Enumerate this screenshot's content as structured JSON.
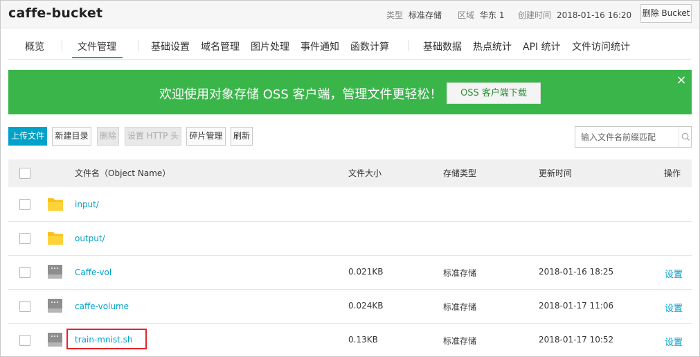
{
  "header": {
    "bucket_name": "caffe-bucket",
    "type_label": "类型",
    "type_value": "标准存储",
    "region_label": "区域",
    "region_value": "华东 1",
    "created_label": "创建时间",
    "created_value": "2018-01-16 16:20",
    "delete_button": "删除 Bucket"
  },
  "tabs": [
    {
      "label": "概览"
    },
    {
      "label": "文件管理"
    },
    {
      "label": "基础设置"
    },
    {
      "label": "域名管理"
    },
    {
      "label": "图片处理"
    },
    {
      "label": "事件通知"
    },
    {
      "label": "函数计算"
    },
    {
      "label": "基础数据"
    },
    {
      "label": "热点统计"
    },
    {
      "label": "API 统计"
    },
    {
      "label": "文件访问统计"
    }
  ],
  "active_tab": "文件管理",
  "banner": {
    "text": "欢迎使用对象存储 OSS 客户端，管理文件更轻松！",
    "button": "OSS 客户端下载",
    "close": "×"
  },
  "toolbar": {
    "upload": "上传文件",
    "new_dir": "新建目录",
    "delete": "删除",
    "set_http_header": "设置 HTTP 头",
    "fragments": "碎片管理",
    "refresh": "刷新",
    "search_placeholder": "输入文件名前缀匹配"
  },
  "table": {
    "columns": {
      "name": "文件名（Object Name）",
      "size": "文件大小",
      "storage": "存储类型",
      "updated": "更新时间",
      "actions": "操作"
    },
    "rows": [
      {
        "type": "folder",
        "name": "input/",
        "size": "",
        "storage": "",
        "updated": "",
        "action": ""
      },
      {
        "type": "folder",
        "name": "output/",
        "size": "",
        "storage": "",
        "updated": "",
        "action": ""
      },
      {
        "type": "file",
        "name": "Caffe-vol",
        "size": "0.021KB",
        "storage": "标准存储",
        "updated": "2018-01-16 18:25",
        "action": "设置"
      },
      {
        "type": "file",
        "name": "caffe-volume",
        "size": "0.024KB",
        "storage": "标准存储",
        "updated": "2018-01-17 11:06",
        "action": "设置"
      },
      {
        "type": "file",
        "name": "train-mnist.sh",
        "size": "0.13KB",
        "storage": "标准存储",
        "updated": "2018-01-17 10:52",
        "action": "设置",
        "highlighted": true
      }
    ]
  },
  "colors": {
    "accent": "#00a2ca",
    "banner_green": "#3ab54a",
    "highlight_red": "#e2262b",
    "folder_yellow": "#f8c012"
  }
}
